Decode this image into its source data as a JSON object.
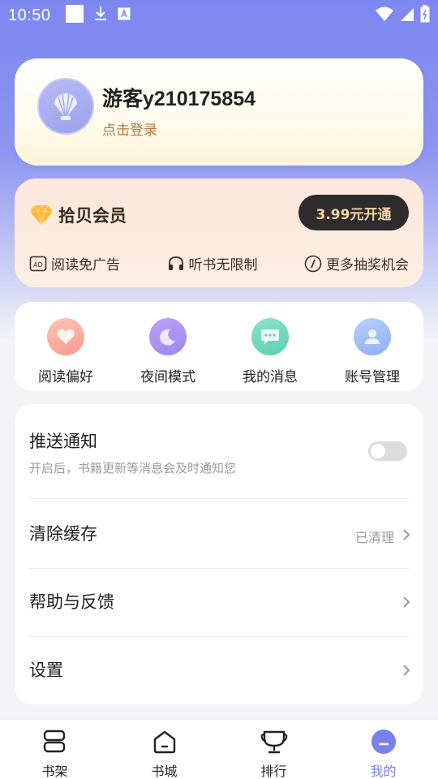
{
  "status_bar": {
    "time": "10:50"
  },
  "profile": {
    "username": "游客y210175854",
    "login_label": "点击登录"
  },
  "vip": {
    "title": "拾贝会员",
    "button_label": "3.99元开通",
    "benefits": [
      {
        "label": "阅读免广告",
        "icon": "ad-free-icon"
      },
      {
        "label": "听书无限制",
        "icon": "headphones-icon"
      },
      {
        "label": "更多抽奖机会",
        "icon": "lottery-icon"
      }
    ]
  },
  "quick_actions": [
    {
      "label": "阅读偏好",
      "icon": "heart-icon"
    },
    {
      "label": "夜间模式",
      "icon": "moon-icon"
    },
    {
      "label": "我的消息",
      "icon": "message-icon"
    },
    {
      "label": "账号管理",
      "icon": "account-icon"
    }
  ],
  "settings": {
    "push": {
      "title": "推送通知",
      "subtitle": "开启后，书籍更新等消息会及时通知您",
      "enabled": false
    },
    "cache": {
      "title": "清除缓存",
      "value": "已清理"
    },
    "help": {
      "title": "帮助与反馈"
    },
    "settings": {
      "title": "设置"
    }
  },
  "bottom_nav": [
    {
      "label": "书架",
      "icon": "bookshelf-icon"
    },
    {
      "label": "书城",
      "icon": "bookstore-icon"
    },
    {
      "label": "排行",
      "icon": "ranking-icon"
    },
    {
      "label": "我的",
      "icon": "profile-icon",
      "active": true
    }
  ],
  "colors": {
    "accent": "#7b80ee",
    "vip_button_bg": "#2d2b2c",
    "vip_button_text": "#f6d6a4",
    "login_link": "#b0793e"
  }
}
